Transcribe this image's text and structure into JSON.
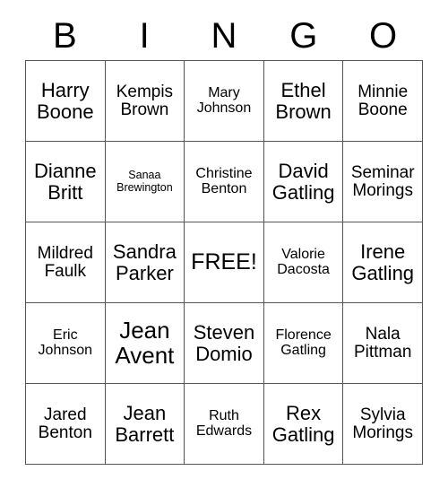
{
  "card": {
    "header_letters": [
      "B",
      "I",
      "N",
      "G",
      "O"
    ],
    "free_space_label": "FREE!",
    "border_color": "#555555",
    "text_color": "#000000",
    "background_color": "#ffffff",
    "rows": [
      [
        {
          "line1": "Harry",
          "line2": "Boone",
          "size": "fs-lg"
        },
        {
          "line1": "Kempis",
          "line2": "Brown",
          "size": "fs-md"
        },
        {
          "line1": "Mary",
          "line2": "Johnson",
          "size": "fs-sm"
        },
        {
          "line1": "Ethel",
          "line2": "Brown",
          "size": "fs-lg"
        },
        {
          "line1": "Minnie",
          "line2": "Boone",
          "size": "fs-md"
        }
      ],
      [
        {
          "line1": "Dianne",
          "line2": "Britt",
          "size": "fs-lg"
        },
        {
          "line1": "Sanaa",
          "line2": "Brewington",
          "size": "fs-xs"
        },
        {
          "line1": "Christine",
          "line2": "Benton",
          "size": "fs-sm"
        },
        {
          "line1": "David",
          "line2": "Gatling",
          "size": "fs-lg"
        },
        {
          "line1": "Seminar",
          "line2": "Morings",
          "size": "fs-md"
        }
      ],
      [
        {
          "line1": "Mildred",
          "line2": "Faulk",
          "size": "fs-md"
        },
        {
          "line1": "Sandra",
          "line2": "Parker",
          "size": "fs-lg"
        },
        {
          "line1": "FREE!",
          "line2": "",
          "size": "fs-free"
        },
        {
          "line1": "Valorie",
          "line2": "Dacosta",
          "size": "fs-sm"
        },
        {
          "line1": "Irene",
          "line2": "Gatling",
          "size": "fs-lg"
        }
      ],
      [
        {
          "line1": "Eric",
          "line2": "Johnson",
          "size": "fs-sm"
        },
        {
          "line1": "Jean",
          "line2": "Avent",
          "size": "fs-xl"
        },
        {
          "line1": "Steven",
          "line2": "Domio",
          "size": "fs-lg"
        },
        {
          "line1": "Florence",
          "line2": "Gatling",
          "size": "fs-sm"
        },
        {
          "line1": "Nala",
          "line2": "Pittman",
          "size": "fs-md"
        }
      ],
      [
        {
          "line1": "Jared",
          "line2": "Benton",
          "size": "fs-md"
        },
        {
          "line1": "Jean",
          "line2": "Barrett",
          "size": "fs-lg"
        },
        {
          "line1": "Ruth",
          "line2": "Edwards",
          "size": "fs-sm"
        },
        {
          "line1": "Rex",
          "line2": "Gatling",
          "size": "fs-lg"
        },
        {
          "line1": "Sylvia",
          "line2": "Morings",
          "size": "fs-md"
        }
      ]
    ]
  }
}
